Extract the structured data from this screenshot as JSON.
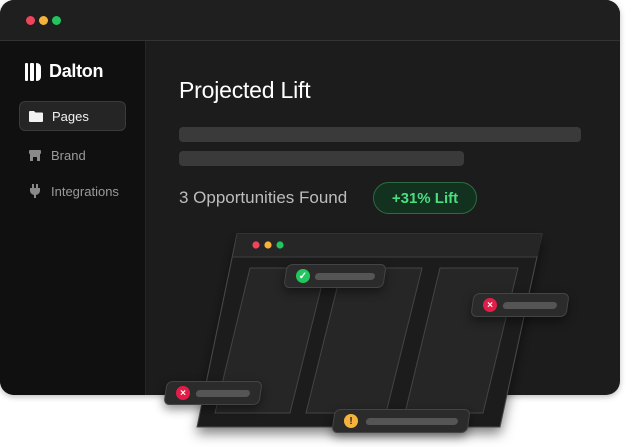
{
  "app": {
    "name": "Dalton"
  },
  "sidebar": {
    "items": [
      {
        "label": "Pages",
        "icon": "folder-icon",
        "active": true
      },
      {
        "label": "Brand",
        "icon": "storefront-icon",
        "active": false
      },
      {
        "label": "Integrations",
        "icon": "plug-icon",
        "active": false
      }
    ]
  },
  "main": {
    "title": "Projected Lift",
    "opportunities_text": "3 Opportunities Found",
    "lift_badge": "+31% Lift"
  },
  "colors": {
    "window_dot_red": "#f0445a",
    "window_dot_yellow": "#f5b33b",
    "window_dot_green": "#22c55e",
    "success": "#22c55e",
    "error": "#e11d48",
    "warning": "#f5b33b",
    "accent_green_text": "#4ade80"
  },
  "mockup": {
    "chips": [
      {
        "status": "check-icon",
        "glyph": "✓"
      },
      {
        "status": "error-icon",
        "glyph": "×"
      },
      {
        "status": "error-icon",
        "glyph": "×"
      },
      {
        "status": "warning-icon",
        "glyph": "!"
      }
    ]
  }
}
